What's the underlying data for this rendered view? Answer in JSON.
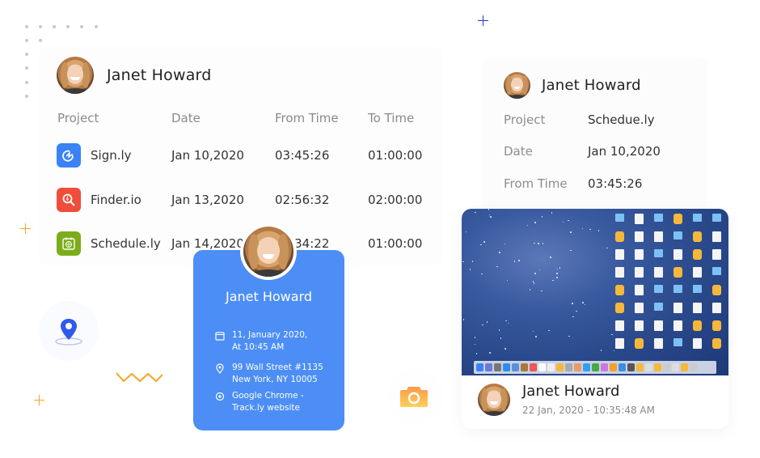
{
  "user": {
    "name": "Janet Howard"
  },
  "table_card": {
    "columns": [
      "Project",
      "Date",
      "From Time",
      "To Time"
    ],
    "rows": [
      {
        "project": "Sign.ly",
        "icon": "signature-icon",
        "icon_color": "#3b82f6",
        "date": "Jan 10,2020",
        "from": "03:45:26",
        "to": "01:00:00"
      },
      {
        "project": "Finder.io",
        "icon": "search-icon",
        "icon_color": "#f04e3a",
        "date": "Jan 13,2020",
        "from": "02:56:32",
        "to": "02:00:00"
      },
      {
        "project": "Schedule.ly",
        "icon": "calendar-globe-icon",
        "icon_color": "#7cac1a",
        "date": "Jan 14,2020",
        "from": "03:34:22",
        "to": "01:00:00"
      }
    ]
  },
  "blue_card": {
    "name": "Janet Howard",
    "date_line1": "11, January 2020,",
    "date_line2": "At 10:45 AM",
    "address_line1": "99 Wall Street #1135",
    "address_line2": "New York, NY 10005",
    "source_line1": "Google Chrome -",
    "source_line2": "Track.ly website",
    "bg_color": "#4c8ef5"
  },
  "detail_card": {
    "name": "Janet Howard",
    "fields": [
      {
        "label": "Project",
        "value": "Schedue.ly"
      },
      {
        "label": "Date",
        "value": "Jan 10,2020"
      },
      {
        "label": "From Time",
        "value": "03:45:26"
      }
    ]
  },
  "screenshot_card": {
    "name": "Janet Howard",
    "timestamp": "22 Jan, 2020 - 10:35:48 AM"
  },
  "colors": {
    "accent_blue": "#4c8ef5",
    "decor_orange": "#f5a623",
    "decor_navy": "#2b2bd6"
  }
}
